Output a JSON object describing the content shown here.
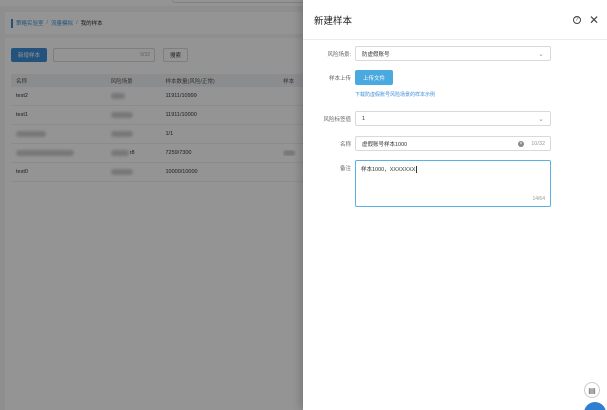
{
  "breadcrumb": {
    "items": [
      "策略实验室",
      "流量模拟",
      "我的样本"
    ],
    "separator": "/"
  },
  "toolbar": {
    "new_label": "新增样本",
    "search_count": "0/32",
    "search_label": "搜索"
  },
  "table": {
    "columns": [
      "名称",
      "风险场景",
      "样本数量(风险/正常)",
      "样本"
    ],
    "rows": [
      {
        "name": "test2",
        "count": "11911/10999",
        "tail": ""
      },
      {
        "name": "test1",
        "count": "11911/10000",
        "tail": ""
      },
      {
        "name": "",
        "count": "1/1",
        "tail": ""
      },
      {
        "name": "",
        "count": "7259/7300",
        "tail": "r8"
      },
      {
        "name": "test0",
        "count": "10000/10000",
        "tail": ""
      }
    ]
  },
  "drawer": {
    "title": "新建样本",
    "fields": {
      "scene": {
        "label": "风险场景:",
        "value": "防虚假账号"
      },
      "upload": {
        "label": "样本上传",
        "button": "上传文件",
        "link": "下载防虚假账号风险场景的样本示例"
      },
      "ratio": {
        "label": "风险标签值",
        "value": "1"
      },
      "name": {
        "label": "名称",
        "value": "虚假账号样本1000",
        "count": "10/32"
      },
      "remark": {
        "label": "备注",
        "value": "样本1000，XXXXXXX",
        "count": "14/64"
      }
    }
  },
  "icons": {
    "help": "help-circle-icon",
    "close": "close-icon",
    "chat": "chat-icon"
  },
  "colors": {
    "primary": "#3d8fd8",
    "upload": "#4aa9de",
    "focus_border": "#5ab0e3"
  }
}
